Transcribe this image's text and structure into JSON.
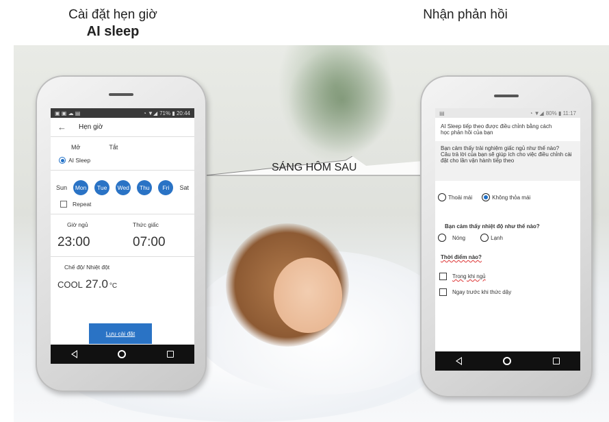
{
  "headings": {
    "left_line1": "Cài đặt hẹn giờ",
    "left_line2": "AI sleep",
    "right": "Nhận phản hồi"
  },
  "transition_label": "SÁNG HÔM SAU",
  "left_phone": {
    "status": {
      "right": "71% ▮ 20:44"
    },
    "header": {
      "back": "←",
      "title": "Hẹn giờ"
    },
    "tabs": [
      "Mở",
      "Tắt"
    ],
    "mode_option": "AI Sleep",
    "days": [
      {
        "label": "Sun",
        "on": false
      },
      {
        "label": "Mon",
        "on": true
      },
      {
        "label": "Tue",
        "on": true
      },
      {
        "label": "Wed",
        "on": true
      },
      {
        "label": "Thu",
        "on": true
      },
      {
        "label": "Fri",
        "on": true
      },
      {
        "label": "Sat",
        "on": false
      }
    ],
    "repeat_label": "Repeat",
    "sleep_label": "Giờ ngủ",
    "sleep_time": "23:00",
    "wake_label": "Thức giấc",
    "wake_time": "07:00",
    "mode_label": "Chế độ/ Nhiệt đột",
    "mode_name": "COOL",
    "temperature": "27.0",
    "temperature_unit": "°C",
    "save_button": "Lưu cài đặt"
  },
  "right_phone": {
    "status": {
      "right": "80% ▮ 11:17"
    },
    "intro": "AI Sleep tiếp theo được điều chỉnh bằng cách học phản hồi của bạn",
    "question1": "Bạn cảm thấy trải nghiệm giấc ngủ như thế nào?",
    "question1_note": "Câu trả lời của bạn sẽ giúp ích cho việc điều chỉnh cài đặt cho lần vận hành tiếp theo",
    "q1_options": [
      {
        "label": "Thoải mái",
        "selected": false
      },
      {
        "label": "Không thỏa mái",
        "selected": true
      }
    ],
    "question2": "Bạn cảm thấy nhiệt độ như thế nào?",
    "q2_options": [
      {
        "label": "Nóng",
        "selected": false
      },
      {
        "label": "Lạnh",
        "selected": false
      }
    ],
    "question3": "Thời điểm nào?",
    "q3_options": [
      "Trong khi ngủ",
      "Ngay trước khi thức dậy"
    ]
  },
  "colors": {
    "accent_blue": "#2a73c5",
    "nav_bar": "#111111"
  }
}
